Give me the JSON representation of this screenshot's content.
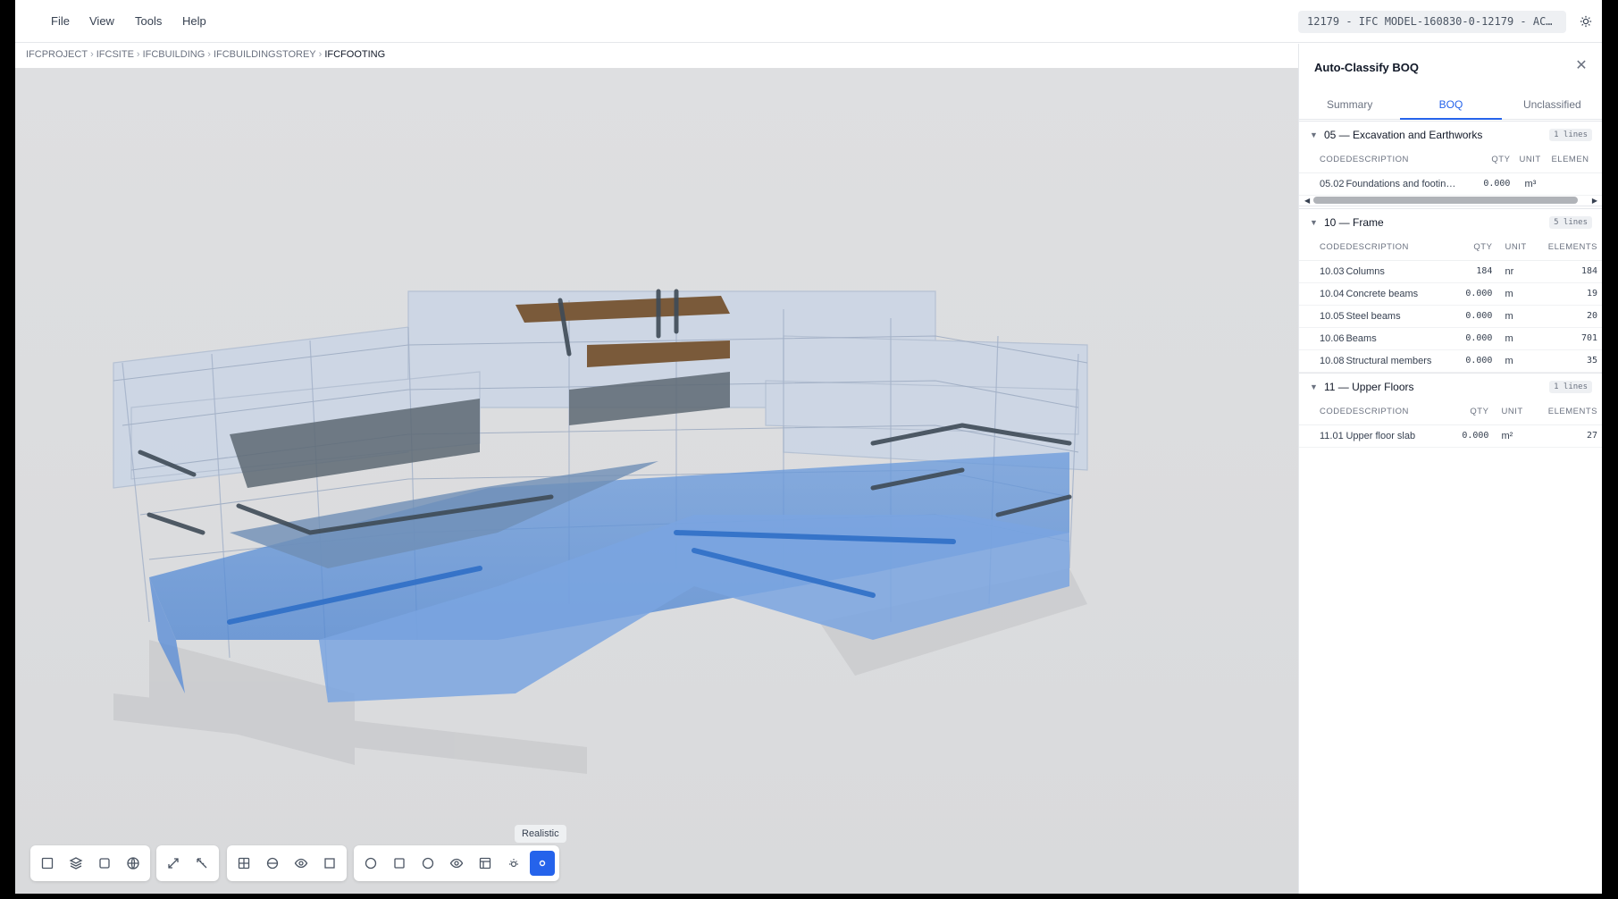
{
  "menu": {
    "file": "File",
    "view": "View",
    "tools": "Tools",
    "help": "Help"
  },
  "window_title": "12179 - IFC MODEL-160830-0-12179 - AC…",
  "breadcrumb": [
    "IFCPROJECT",
    "IFCSITE",
    "IFCBUILDING",
    "IFCBUILDINGSTOREY",
    "IFCFOOTING"
  ],
  "toolbar": {
    "tooltip": "Realistic",
    "groups": [
      [
        "select-icon",
        "layers-icon",
        "box-icon",
        "globe-icon"
      ],
      [
        "expand-icon",
        "measure-icon"
      ],
      [
        "grid-icon",
        "section-icon",
        "eye-icon",
        "square-icon"
      ],
      [
        "circle-icon",
        "square-icon",
        "circle-icon",
        "eye-icon",
        "layout-icon",
        "sun-icon",
        "realistic-icon"
      ]
    ],
    "active": "realistic-icon"
  },
  "panel": {
    "title": "Auto-Classify BOQ",
    "tabs": [
      "Summary",
      "BOQ",
      "Unclassified"
    ],
    "active_tab": "BOQ",
    "columns": {
      "code": "CODE",
      "description": "DESCRIPTION",
      "qty": "QTY",
      "unit": "UNIT",
      "elements": "ELEMENTS",
      "elements_truncated": "ELEMEN"
    },
    "sections": [
      {
        "title": "05 — Excavation and Earthworks",
        "badge": "1 lines",
        "rows": [
          {
            "code": "05.02",
            "description": "Foundations and footin…",
            "qty": "0.000",
            "unit": "m³",
            "elements": ""
          }
        ]
      },
      {
        "title": "10 — Frame",
        "badge": "5 lines",
        "rows": [
          {
            "code": "10.03",
            "description": "Columns",
            "qty": "184",
            "unit": "nr",
            "elements": "184"
          },
          {
            "code": "10.04",
            "description": "Concrete beams",
            "qty": "0.000",
            "unit": "m",
            "elements": "19"
          },
          {
            "code": "10.05",
            "description": "Steel beams",
            "qty": "0.000",
            "unit": "m",
            "elements": "20"
          },
          {
            "code": "10.06",
            "description": "Beams",
            "qty": "0.000",
            "unit": "m",
            "elements": "701"
          },
          {
            "code": "10.08",
            "description": "Structural members",
            "qty": "0.000",
            "unit": "m",
            "elements": "35"
          }
        ]
      },
      {
        "title": "11 — Upper Floors",
        "badge": "1 lines",
        "rows": [
          {
            "code": "11.01",
            "description": "Upper floor slab",
            "qty": "0.000",
            "unit": "m²",
            "elements": "27"
          }
        ]
      }
    ]
  },
  "colors": {
    "accent": "#2563eb",
    "viewport_bg": "#dcdddf",
    "glass_blue": "#5b8fd6"
  }
}
